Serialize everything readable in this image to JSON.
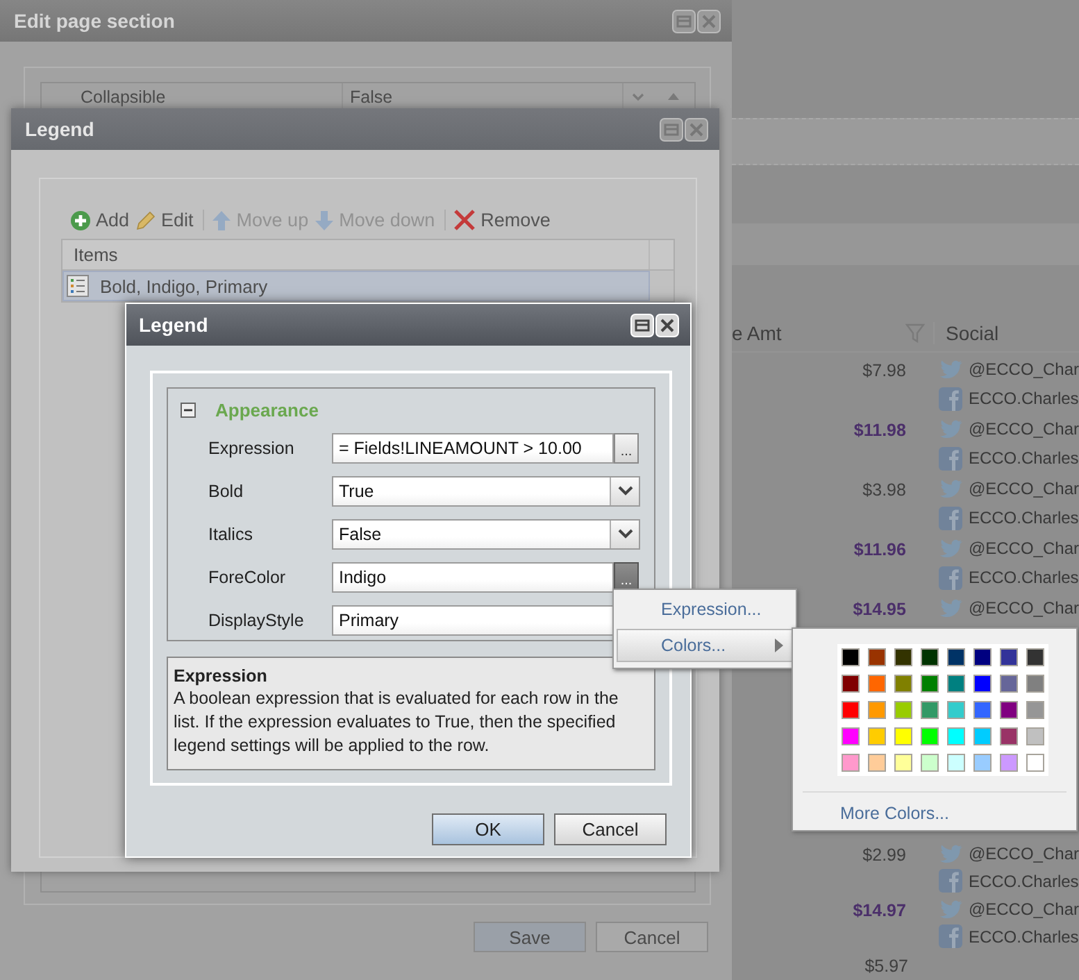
{
  "background_page": {
    "table": {
      "columns": [
        "e Amt",
        "Social"
      ],
      "rows": [
        {
          "amount": "$7.98",
          "bold": false,
          "twitter": "@ECCO_Char",
          "facebook": "ECCO.Charles"
        },
        {
          "amount": "$11.98",
          "bold": true,
          "twitter": "@ECCO_Char",
          "facebook": "ECCO.Charles"
        },
        {
          "amount": "$3.98",
          "bold": false,
          "twitter": "@ECCO_Char",
          "facebook": "ECCO.Charles"
        },
        {
          "amount": "$11.96",
          "bold": true,
          "twitter": "@ECCO_Char",
          "facebook": "ECCO.Charles"
        },
        {
          "amount": "$14.95",
          "bold": true,
          "twitter": "@ECCO_Char"
        }
      ],
      "lower_rows": [
        {
          "amount": "$2.99",
          "bold": false,
          "twitter": "@ECCO_Char",
          "facebook": "ECCO.Charles"
        },
        {
          "amount": "$14.97",
          "bold": true,
          "twitter": "@ECCO_Char",
          "facebook": "ECCO.Charles"
        },
        {
          "amount": "$5.97",
          "bold": false
        }
      ]
    }
  },
  "edit_window": {
    "title": "Edit page section",
    "property": {
      "name": "Collapsible",
      "value": "False"
    },
    "buttons": [
      "Save",
      "Cancel"
    ]
  },
  "legend_window": {
    "title": "Legend",
    "toolbar": [
      {
        "label": "Add",
        "kind": "add",
        "disabled": false
      },
      {
        "label": "Edit",
        "kind": "edit",
        "disabled": false
      },
      {
        "label": "Move up",
        "kind": "up",
        "disabled": true
      },
      {
        "label": "Move down",
        "kind": "down",
        "disabled": true
      },
      {
        "label": "Remove",
        "kind": "remove",
        "disabled": false
      }
    ],
    "items": {
      "columns": [
        "Items"
      ],
      "rows": [
        {
          "text": "Bold, Indigo, Primary",
          "selected": true
        }
      ]
    }
  },
  "legend_dialog": {
    "title": "Legend",
    "section": "Appearance",
    "expanded": true,
    "properties": [
      {
        "label": "Expression",
        "value": "= Fields!LINEAMOUNT > 10.00",
        "kind": "builder",
        "button": "...",
        "pressed": false
      },
      {
        "label": "Bold",
        "value": "True",
        "kind": "dropdown"
      },
      {
        "label": "Italics",
        "value": "False",
        "kind": "dropdown"
      },
      {
        "label": "ForeColor",
        "value": "Indigo",
        "kind": "builder",
        "button": "...",
        "pressed": true
      },
      {
        "label": "DisplayStyle",
        "value": "Primary",
        "kind": "text"
      }
    ],
    "description": {
      "title": "Expression",
      "text": "A boolean expression that is evaluated for each row in the list. If the expression evaluates to True, then the specified legend settings will be applied to the row."
    },
    "buttons": [
      {
        "label": "OK",
        "kind": "primary"
      },
      {
        "label": "Cancel",
        "kind": "secondary"
      }
    ]
  },
  "context_menu": {
    "items": [
      {
        "label": "Expression...",
        "selected": false,
        "submenu": false
      },
      {
        "label": "Colors...",
        "selected": true,
        "submenu": true
      }
    ]
  },
  "color_palette": {
    "swatches": [
      {
        "color": "#000000"
      },
      {
        "color": "#993300"
      },
      {
        "color": "#333300"
      },
      {
        "color": "#003300"
      },
      {
        "color": "#003366"
      },
      {
        "color": "#000080"
      },
      {
        "color": "#333399"
      },
      {
        "color": "#333333"
      },
      {
        "color": "#800000"
      },
      {
        "color": "#ff6600"
      },
      {
        "color": "#808000"
      },
      {
        "color": "#008000"
      },
      {
        "color": "#008080"
      },
      {
        "color": "#0000ff"
      },
      {
        "color": "#666699"
      },
      {
        "color": "#808080"
      },
      {
        "color": "#ff0000"
      },
      {
        "color": "#ff9900"
      },
      {
        "color": "#99cc00"
      },
      {
        "color": "#339966"
      },
      {
        "color": "#33cccc"
      },
      {
        "color": "#3366ff"
      },
      {
        "color": "#800080"
      },
      {
        "color": "#969696"
      },
      {
        "color": "#ff00ff"
      },
      {
        "color": "#ffcc00"
      },
      {
        "color": "#ffff00"
      },
      {
        "color": "#00ff00"
      },
      {
        "color": "#00ffff"
      },
      {
        "color": "#00ccff"
      },
      {
        "color": "#993366"
      },
      {
        "color": "#c0c0c0"
      },
      {
        "color": "#ff99cc"
      },
      {
        "color": "#ffcc99"
      },
      {
        "color": "#ffff99"
      },
      {
        "color": "#ccffcc"
      },
      {
        "color": "#ccffff"
      },
      {
        "color": "#99ccff"
      },
      {
        "color": "#cc99ff"
      },
      {
        "color": "#ffffff"
      }
    ],
    "more": "More Colors..."
  }
}
